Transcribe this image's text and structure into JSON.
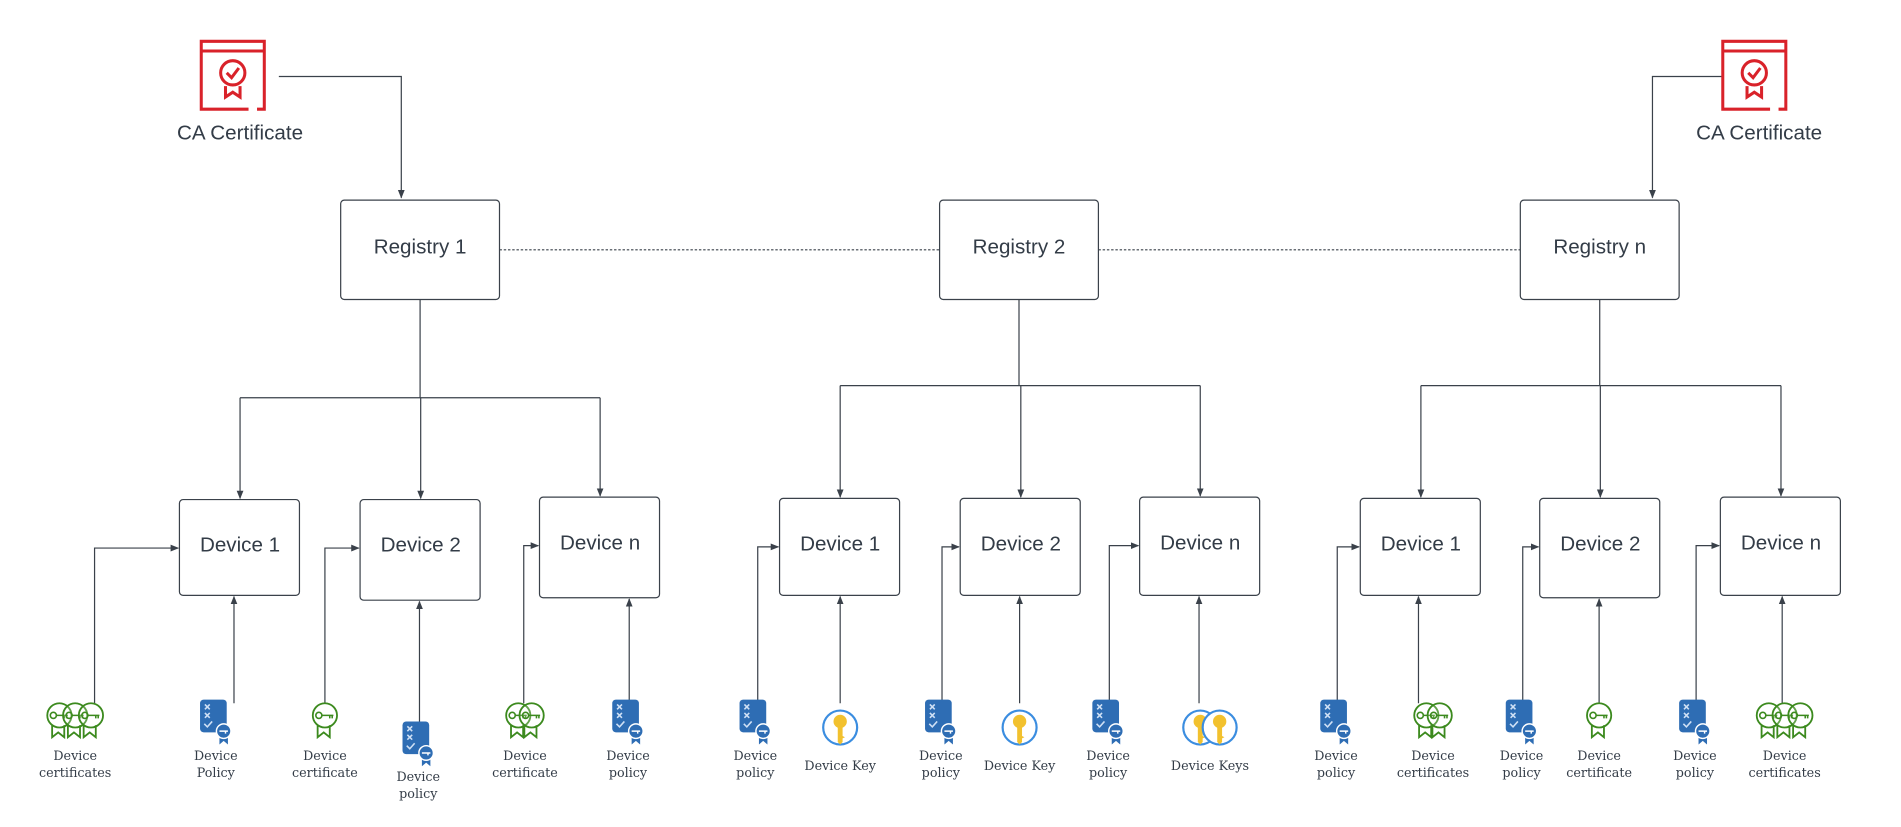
{
  "ca_certificates": [
    {
      "label": "CA Certificate",
      "color": "#d9222a"
    },
    {
      "label": "CA Certificate",
      "color": "#d9222a"
    }
  ],
  "colors": {
    "certificate": "#3c8a1e",
    "policy": "#2e6db4",
    "key": "#f2c12e",
    "key_ring": "#3b8de0"
  },
  "registries": [
    {
      "label": "Registry 1",
      "devices": [
        {
          "label": "Device 1",
          "inputs": [
            {
              "type": "certificate",
              "count": 3,
              "label": [
                "Device",
                "certificates"
              ]
            },
            {
              "type": "policy",
              "count": 1,
              "label": [
                "Device",
                "Policy"
              ]
            }
          ]
        },
        {
          "label": "Device 2",
          "inputs": [
            {
              "type": "certificate",
              "count": 1,
              "label": [
                "Device",
                "certificate"
              ]
            },
            {
              "type": "policy",
              "count": 1,
              "label": [
                "Device",
                "policy"
              ]
            }
          ]
        },
        {
          "label": "Device n",
          "inputs": [
            {
              "type": "certificate",
              "count": 2,
              "label": [
                "Device",
                "certificate"
              ]
            },
            {
              "type": "policy",
              "count": 1,
              "label": [
                "Device",
                "policy"
              ]
            }
          ]
        }
      ]
    },
    {
      "label": "Registry 2",
      "devices": [
        {
          "label": "Device 1",
          "inputs": [
            {
              "type": "policy",
              "count": 1,
              "label": [
                "Device",
                "policy"
              ]
            },
            {
              "type": "key",
              "count": 1,
              "label": [
                "Device Key"
              ]
            }
          ]
        },
        {
          "label": "Device 2",
          "inputs": [
            {
              "type": "policy",
              "count": 1,
              "label": [
                "Device",
                "policy"
              ]
            },
            {
              "type": "key",
              "count": 1,
              "label": [
                "Device Key"
              ]
            }
          ]
        },
        {
          "label": "Device n",
          "inputs": [
            {
              "type": "policy",
              "count": 1,
              "label": [
                "Device",
                "policy"
              ]
            },
            {
              "type": "key",
              "count": 2,
              "label": [
                "Device Keys"
              ]
            }
          ]
        }
      ]
    },
    {
      "label": "Registry n",
      "devices": [
        {
          "label": "Device 1",
          "inputs": [
            {
              "type": "policy",
              "count": 1,
              "label": [
                "Device",
                "policy"
              ]
            },
            {
              "type": "certificate",
              "count": 2,
              "label": [
                "Device",
                "certificates"
              ]
            }
          ]
        },
        {
          "label": "Device 2",
          "inputs": [
            {
              "type": "policy",
              "count": 1,
              "label": [
                "Device",
                "policy"
              ]
            },
            {
              "type": "certificate",
              "count": 1,
              "label": [
                "Device",
                "certificate"
              ]
            }
          ]
        },
        {
          "label": "Device n",
          "inputs": [
            {
              "type": "policy",
              "count": 1,
              "label": [
                "Device",
                "policy"
              ]
            },
            {
              "type": "certificate",
              "count": 3,
              "label": [
                "Device",
                "certificates"
              ]
            }
          ]
        }
      ]
    }
  ]
}
